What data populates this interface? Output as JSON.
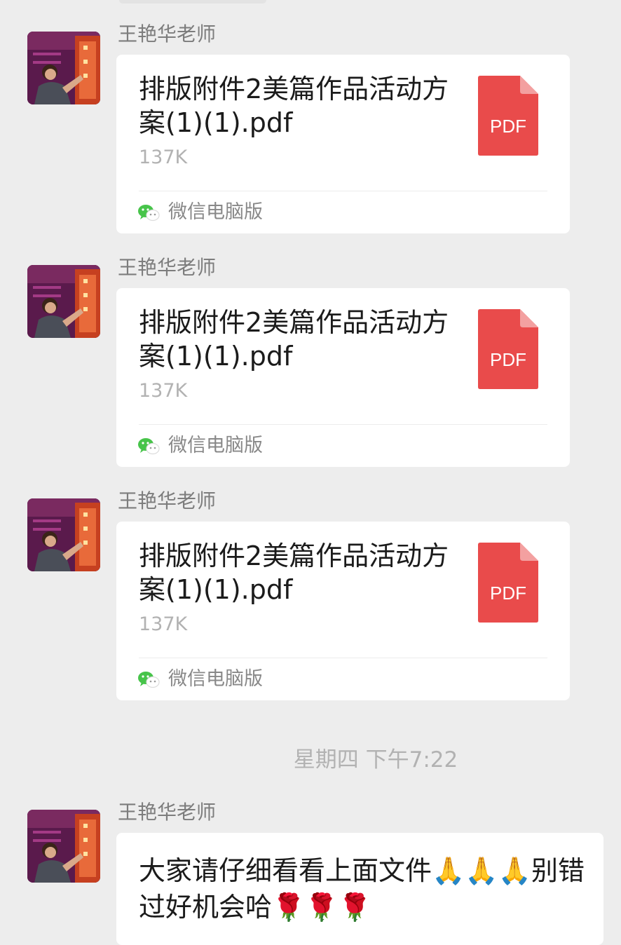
{
  "chat": {
    "messages": [
      {
        "sender": "王艳华老师",
        "file_name": "排版附件2美篇作品活动方案(1)(1).pdf",
        "file_size": "137K",
        "file_type": "PDF",
        "source": "微信电脑版"
      },
      {
        "sender": "王艳华老师",
        "file_name": "排版附件2美篇作品活动方案(1)(1).pdf",
        "file_size": "137K",
        "file_type": "PDF",
        "source": "微信电脑版"
      },
      {
        "sender": "王艳华老师",
        "file_name": "排版附件2美篇作品活动方案(1)(1).pdf",
        "file_size": "137K",
        "file_type": "PDF",
        "source": "微信电脑版"
      }
    ],
    "timestamp": "星期四 下午7:22",
    "text_message": {
      "sender": "王艳华老师",
      "text": "大家请仔细看看上面文件🙏🙏🙏别错过好机会哈🌹🌹🌹"
    }
  },
  "colors": {
    "background": "#ededed",
    "bubble": "#ffffff",
    "pdf_red": "#e94b4b",
    "pdf_fold": "#f3a0a0",
    "wechat_green": "#47c44a"
  },
  "icons": {
    "file_type": "pdf-file-icon",
    "source": "wechat-icon",
    "avatar": "sender-avatar"
  }
}
